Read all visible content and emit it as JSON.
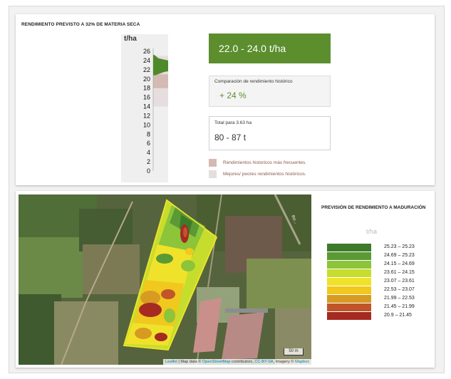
{
  "top": {
    "title": "RENDIMIENTO PREVISTO A 32% DE MATERIA SECA",
    "unit": "t/ha",
    "main_range": "22.0 - 24.0 t/ha",
    "historical": {
      "label": "Comparación de rendimiento histórico",
      "value": "+ 24 %"
    },
    "total": {
      "label": "Total para 3.63 ha",
      "value": "80 - 87 t"
    },
    "legend": [
      {
        "label": "Rendimientos historicos más frecuentes.",
        "color": "#d3bab3"
      },
      {
        "label": "Mejores/ peores rendimientos históricos.",
        "color": "#e6dede"
      }
    ]
  },
  "chart_data": {
    "type": "area",
    "ylabel": "t/ha",
    "ylim": [
      0,
      26
    ],
    "yticks": [
      0,
      2,
      4,
      6,
      8,
      10,
      12,
      14,
      16,
      18,
      20,
      22,
      24,
      26
    ],
    "bands": [
      {
        "name": "Rendimientos historicos más frecuentes.",
        "from": 18,
        "to": 21,
        "color": "#d3bab3"
      },
      {
        "name": "Mejores/ peores rendimientos históricos.",
        "from": 14,
        "to": 25,
        "color": "#e6dede"
      }
    ],
    "distribution": {
      "color": "#4e8a2a",
      "x": [
        20.8,
        21.5,
        22.0,
        22.5,
        23.0,
        23.5,
        24.0,
        24.5,
        25.2
      ],
      "y": [
        0.05,
        0.25,
        0.55,
        0.8,
        1.0,
        0.7,
        0.35,
        0.12,
        0.03
      ]
    }
  },
  "map": {
    "attribution_leaflet": "Leaflet",
    "attribution_text1": " | Map data © ",
    "attribution_osm": "OpenStreetMap",
    "attribution_text2": " contributors, ",
    "attribution_cc": "CC-BY-SA",
    "attribution_text3": ", Imagery © ",
    "attribution_mapbox": "Mapbox",
    "scale_label": "50 m",
    "road_label": "Ro..."
  },
  "maturation": {
    "title": "PREVISIÓN DE RENDIMIENTO A MADURACIÓN",
    "unit": "t/ha",
    "classes": [
      {
        "range": "25.23  –  25.23",
        "color": "#3d7a2a"
      },
      {
        "range": "24.69  –  25.23",
        "color": "#5a9a35"
      },
      {
        "range": "24.15  –  24.69",
        "color": "#8cc43a"
      },
      {
        "range": "23.61  –  24.15",
        "color": "#c6dd2e"
      },
      {
        "range": "23.07  –  23.61",
        "color": "#f0e22a"
      },
      {
        "range": "22.53  –  23.07",
        "color": "#f0c81e"
      },
      {
        "range": "21.99  –  22.53",
        "color": "#d79a22"
      },
      {
        "range": "21.45  –  21.99",
        "color": "#c0552a"
      },
      {
        "range": "20.9  –  21.45",
        "color": "#a52a22"
      }
    ]
  }
}
